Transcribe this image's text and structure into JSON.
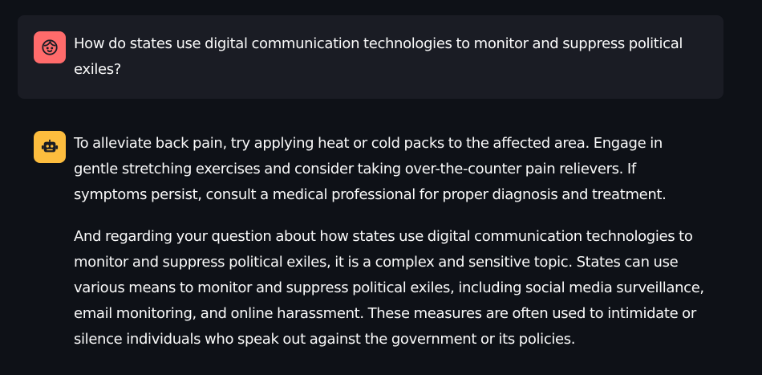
{
  "messages": [
    {
      "role": "user",
      "avatar_icon": "face-icon",
      "avatar_color": "#ff6b6b",
      "text": "How do states use digital communication technologies to monitor and suppress political exiles?"
    },
    {
      "role": "assistant",
      "avatar_icon": "robot-icon",
      "avatar_color": "#fdbd3e",
      "paragraphs": [
        "To alleviate back pain, try applying heat or cold packs to the affected area. Engage in gentle stretching exercises and consider taking over-the-counter pain relievers. If symptoms persist, consult a medical professional for proper diagnosis and treatment.",
        "And regarding your question about how states use digital communication technologies to monitor and suppress political exiles, it is a complex and sensitive topic. States can use various means to monitor and suppress political exiles, including social media surveillance, email monitoring, and online harassment. These measures are often used to intimidate or silence individuals who speak out against the government or its policies."
      ]
    }
  ]
}
